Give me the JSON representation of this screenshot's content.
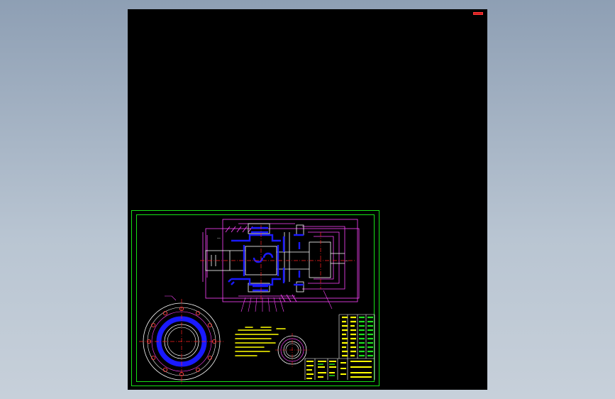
{
  "canvas": {
    "background": "#000000",
    "frame_color": "#16e016",
    "outline_color": "#ff44ff",
    "part_color": "#1a1aff",
    "dimension_color": "#ffffff",
    "centerline_color": "#ff2020",
    "table_color": "#ffff00"
  },
  "icons": {
    "corner": "close-icon"
  }
}
